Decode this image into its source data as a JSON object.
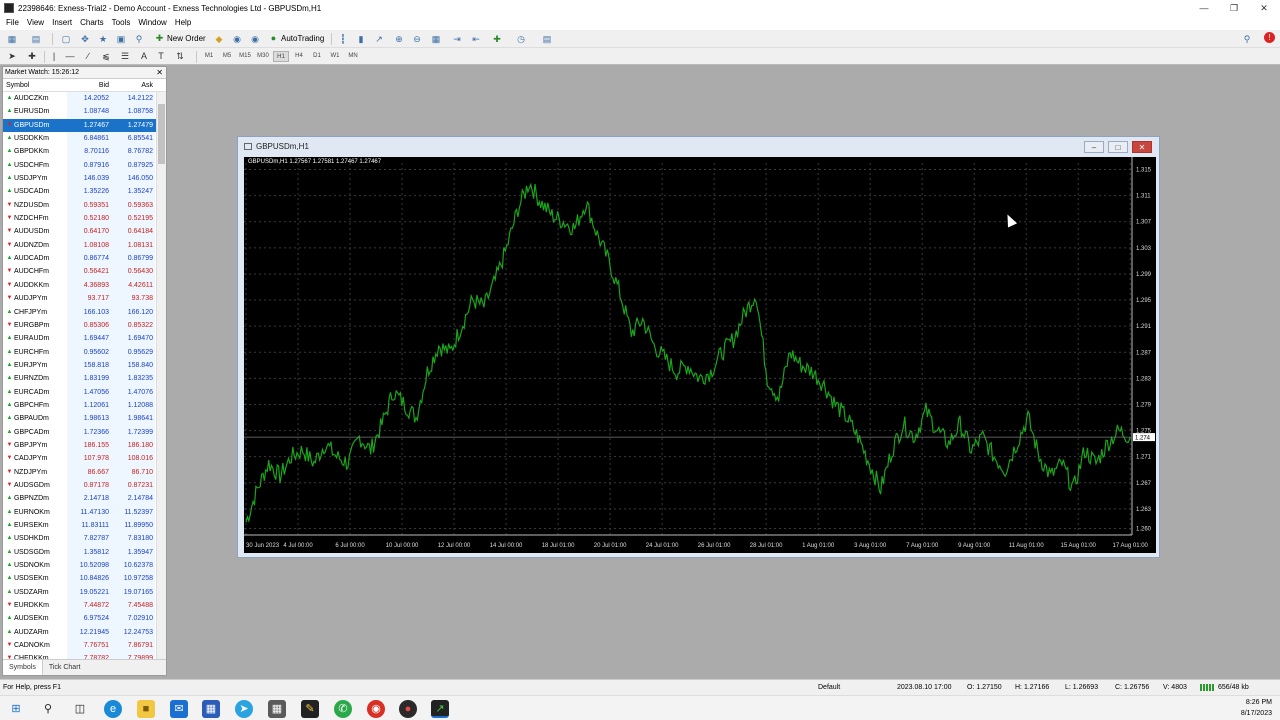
{
  "window": {
    "title": "22398646: Exness-Trial2 - Demo Account - Exness Technologies Ltd - GBPUSDm,H1"
  },
  "menu": [
    "File",
    "View",
    "Insert",
    "Charts",
    "Tools",
    "Window",
    "Help"
  ],
  "toolbar": {
    "new_order": "New Order",
    "auto_trading": "AutoTrading",
    "timeframes": [
      "M1",
      "M5",
      "M15",
      "M30",
      "H1",
      "H4",
      "D1",
      "W1",
      "MN"
    ],
    "active_timeframe": "H1"
  },
  "market_watch": {
    "title": "Market Watch: 15:26:12",
    "col_symbol": "Symbol",
    "col_bid": "Bid",
    "col_ask": "Ask",
    "selected": "GBPUSDm",
    "rows": [
      {
        "symbol": "AUDCZKm",
        "bid": "14.2052",
        "ask": "14.2122",
        "dir": "up"
      },
      {
        "symbol": "EURUSDm",
        "bid": "1.08748",
        "ask": "1.08758",
        "dir": "up"
      },
      {
        "symbol": "GBPUSDm",
        "bid": "1.27467",
        "ask": "1.27479",
        "dir": "down"
      },
      {
        "symbol": "USDDKKm",
        "bid": "6.84861",
        "ask": "6.85541",
        "dir": "up"
      },
      {
        "symbol": "GBPDKKm",
        "bid": "8.70116",
        "ask": "8.76782",
        "dir": "up"
      },
      {
        "symbol": "USDCHFm",
        "bid": "0.87916",
        "ask": "0.87925",
        "dir": "up"
      },
      {
        "symbol": "USDJPYm",
        "bid": "146.039",
        "ask": "146.050",
        "dir": "up"
      },
      {
        "symbol": "USDCADm",
        "bid": "1.35226",
        "ask": "1.35247",
        "dir": "up"
      },
      {
        "symbol": "NZDUSDm",
        "bid": "0.59351",
        "ask": "0.59363",
        "dir": "down"
      },
      {
        "symbol": "NZDCHFm",
        "bid": "0.52180",
        "ask": "0.52195",
        "dir": "down"
      },
      {
        "symbol": "AUDUSDm",
        "bid": "0.64170",
        "ask": "0.64184",
        "dir": "down"
      },
      {
        "symbol": "AUDNZDm",
        "bid": "1.08108",
        "ask": "1.08131",
        "dir": "down"
      },
      {
        "symbol": "AUDCADm",
        "bid": "0.86774",
        "ask": "0.86799",
        "dir": "up"
      },
      {
        "symbol": "AUDCHFm",
        "bid": "0.56421",
        "ask": "0.56430",
        "dir": "down"
      },
      {
        "symbol": "AUDDKKm",
        "bid": "4.36893",
        "ask": "4.42611",
        "dir": "down"
      },
      {
        "symbol": "AUDJPYm",
        "bid": "93.717",
        "ask": "93.738",
        "dir": "down"
      },
      {
        "symbol": "CHFJPYm",
        "bid": "166.103",
        "ask": "166.120",
        "dir": "up"
      },
      {
        "symbol": "EURGBPm",
        "bid": "0.85306",
        "ask": "0.85322",
        "dir": "down"
      },
      {
        "symbol": "EURAUDm",
        "bid": "1.69447",
        "ask": "1.69470",
        "dir": "up"
      },
      {
        "symbol": "EURCHFm",
        "bid": "0.95602",
        "ask": "0.95629",
        "dir": "up"
      },
      {
        "symbol": "EURJPYm",
        "bid": "158.818",
        "ask": "158.840",
        "dir": "up"
      },
      {
        "symbol": "EURNZDm",
        "bid": "1.83199",
        "ask": "1.83235",
        "dir": "up"
      },
      {
        "symbol": "EURCADm",
        "bid": "1.47056",
        "ask": "1.47076",
        "dir": "up"
      },
      {
        "symbol": "GBPCHFm",
        "bid": "1.12061",
        "ask": "1.12088",
        "dir": "up"
      },
      {
        "symbol": "GBPAUDm",
        "bid": "1.98613",
        "ask": "1.98641",
        "dir": "up"
      },
      {
        "symbol": "GBPCADm",
        "bid": "1.72366",
        "ask": "1.72399",
        "dir": "up"
      },
      {
        "symbol": "GBPJPYm",
        "bid": "186.155",
        "ask": "186.180",
        "dir": "down"
      },
      {
        "symbol": "CADJPYm",
        "bid": "107.978",
        "ask": "108.016",
        "dir": "down"
      },
      {
        "symbol": "NZDJPYm",
        "bid": "86.667",
        "ask": "86.710",
        "dir": "down"
      },
      {
        "symbol": "AUDSGDm",
        "bid": "0.87178",
        "ask": "0.87231",
        "dir": "down"
      },
      {
        "symbol": "GBPNZDm",
        "bid": "2.14718",
        "ask": "2.14784",
        "dir": "up"
      },
      {
        "symbol": "EURNOKm",
        "bid": "11.47130",
        "ask": "11.52397",
        "dir": "up"
      },
      {
        "symbol": "EURSEKm",
        "bid": "11.83111",
        "ask": "11.89950",
        "dir": "up"
      },
      {
        "symbol": "USDHKDm",
        "bid": "7.82787",
        "ask": "7.83180",
        "dir": "up"
      },
      {
        "symbol": "USDSGDm",
        "bid": "1.35812",
        "ask": "1.35947",
        "dir": "up"
      },
      {
        "symbol": "USDNOKm",
        "bid": "10.52098",
        "ask": "10.62378",
        "dir": "up"
      },
      {
        "symbol": "USDSEKm",
        "bid": "10.84826",
        "ask": "10.97258",
        "dir": "up"
      },
      {
        "symbol": "USDZARm",
        "bid": "19.05221",
        "ask": "19.07165",
        "dir": "up"
      },
      {
        "symbol": "EURDKKm",
        "bid": "7.44872",
        "ask": "7.45488",
        "dir": "down"
      },
      {
        "symbol": "AUDSEKm",
        "bid": "6.97524",
        "ask": "7.02910",
        "dir": "up"
      },
      {
        "symbol": "AUDZARm",
        "bid": "12.21945",
        "ask": "12.24753",
        "dir": "up"
      },
      {
        "symbol": "CADNOKm",
        "bid": "7.76751",
        "ask": "7.86791",
        "dir": "down"
      },
      {
        "symbol": "CHFDKKm",
        "bid": "7.78782",
        "ask": "7.79899",
        "dir": "down"
      }
    ],
    "tabs": [
      "Symbols",
      "Tick Chart"
    ]
  },
  "chart": {
    "window_title": "GBPUSDm,H1",
    "ohlc_label": "GBPUSDm,H1  1.27567 1.27581 1.27467 1.27467",
    "current_price_label": "1.274",
    "line_color": "#1aa51a"
  },
  "chart_data": {
    "type": "line",
    "ylim": [
      1.259,
      1.316
    ],
    "y_ticks": [
      "1.315",
      "1.311",
      "1.307",
      "1.303",
      "1.299",
      "1.295",
      "1.291",
      "1.287",
      "1.283",
      "1.279",
      "1.275",
      "1.271",
      "1.267",
      "1.263",
      "1.260"
    ],
    "x_ticks": [
      "30 Jun 2023",
      "4 Jul 00:00",
      "6 Jul 00:00",
      "10 Jul 00:00",
      "12 Jul 00:00",
      "14 Jul 00:00",
      "18 Jul 01:00",
      "20 Jul 01:00",
      "24 Jul 01:00",
      "26 Jul 01:00",
      "28 Jul 01:00",
      "1 Aug 01:00",
      "3 Aug 01:00",
      "7 Aug 01:00",
      "9 Aug 01:00",
      "11 Aug 01:00",
      "15 Aug 01:00",
      "17 Aug 01:00"
    ],
    "series": [
      {
        "values": [
          1.261,
          1.266,
          1.27,
          1.268,
          1.271,
          1.272,
          1.27,
          1.273,
          1.271,
          1.27,
          1.274,
          1.272,
          1.276,
          1.281,
          1.279,
          1.277,
          1.284,
          1.288,
          1.287,
          1.291,
          1.295,
          1.294,
          1.298,
          1.303,
          1.309,
          1.313,
          1.31,
          1.308,
          1.307,
          1.306,
          1.31,
          1.305,
          1.301,
          1.296,
          1.29,
          1.292,
          1.288,
          1.286,
          1.284,
          1.285,
          1.283,
          1.284,
          1.287,
          1.289,
          1.293,
          1.296,
          1.283,
          1.28,
          1.287,
          1.285,
          1.284,
          1.282,
          1.279,
          1.277,
          1.274,
          1.27,
          1.266,
          1.272,
          1.276,
          1.274,
          1.278,
          1.275,
          1.273,
          1.276,
          1.272,
          1.274,
          1.271,
          1.269,
          1.273,
          1.277,
          1.271,
          1.268,
          1.27,
          1.266,
          1.272,
          1.27,
          1.273,
          1.275,
          1.274
        ]
      }
    ]
  },
  "status": {
    "help": "For Help, press F1",
    "profile": "Default",
    "datetime": "2023.08.10 17:00",
    "open": "O: 1.27150",
    "high": "H: 1.27166",
    "low": "L: 1.26693",
    "close": "C: 1.26756",
    "volume": "V: 4803",
    "traffic": "656/48 kb"
  },
  "taskbar": {
    "time": "8:26 PM",
    "date": "8/17/2023"
  }
}
